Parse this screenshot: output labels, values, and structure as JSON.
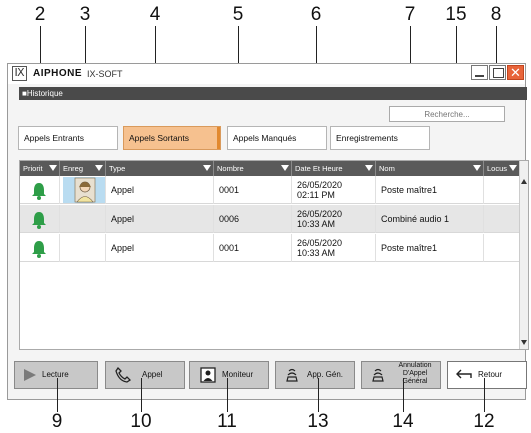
{
  "callouts": {
    "top": [
      "2",
      "3",
      "4",
      "5",
      "6",
      "7",
      "15",
      "8"
    ],
    "bottom": [
      "9",
      "10",
      "11",
      "13",
      "14",
      "12"
    ]
  },
  "titlebar": {
    "brand": "AIPHONE",
    "product": "IX-SOFT",
    "logo_icon": "ix-logo-icon",
    "close_glyph": "✕"
  },
  "section_title": "■Historique",
  "search": {
    "placeholder": "Recherche..."
  },
  "tabs": [
    {
      "label": "Appels Entrants",
      "active": false
    },
    {
      "label": "Appels Sortants",
      "active": true
    },
    {
      "label": "Appels Manqués",
      "active": false
    },
    {
      "label": "Enregistrements",
      "active": false
    }
  ],
  "table": {
    "headers": [
      "Priorit",
      "Enreg",
      "Type",
      "Nombre",
      "Date Et Heure",
      "Nom",
      "Locus"
    ],
    "rows": [
      {
        "priority_icon": "bell-icon",
        "has_recording": true,
        "type": "Appel",
        "number": "0001",
        "date": "26/05/2020",
        "time": "02:11 PM",
        "name": "Poste maître1"
      },
      {
        "priority_icon": "bell-icon",
        "has_recording": false,
        "type": "Appel",
        "number": "0006",
        "date": "26/05/2020",
        "time": "10:33 AM",
        "name": "Combiné audio 1"
      },
      {
        "priority_icon": "bell-icon",
        "has_recording": false,
        "type": "Appel",
        "number": "0001",
        "date": "26/05/2020",
        "time": "10:33 AM",
        "name": "Poste maître1"
      }
    ]
  },
  "buttons": {
    "lecture": "Lecture",
    "appel": "Appel",
    "moniteur": "Moniteur",
    "app_gen": "App. Gén.",
    "annulation_1": "Annulation",
    "annulation_2": "D'Appel",
    "annulation_3": "Général",
    "retour": "Retour"
  },
  "colors": {
    "accent_tab": "#f6c18f",
    "bell_green": "#2e9e48",
    "header_bg": "#5a5a5a",
    "close_button": "#e8643a"
  }
}
